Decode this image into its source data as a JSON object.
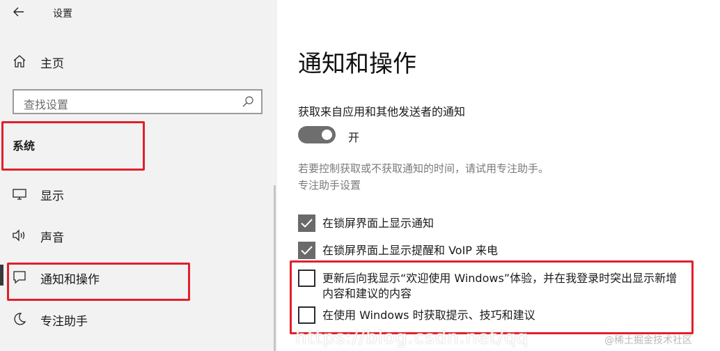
{
  "app": {
    "title": "设置",
    "back_icon": "arrow-left-icon"
  },
  "nav": {
    "home": {
      "label": "主页",
      "icon": "home-icon"
    },
    "group": "系统",
    "items": [
      {
        "label": "显示",
        "icon": "monitor-icon"
      },
      {
        "label": "声音",
        "icon": "speaker-icon"
      },
      {
        "label": "通知和操作",
        "icon": "message-icon",
        "selected": true
      },
      {
        "label": "专注助手",
        "icon": "moon-icon"
      }
    ]
  },
  "search": {
    "placeholder": "查找设置",
    "icon": "search-icon"
  },
  "main": {
    "title": "通知和操作",
    "notifications_label": "获取来自应用和其他发送者的通知",
    "toggle": {
      "state": "开",
      "on": true
    },
    "description": "若要控制获取或不获取通知的时间，请试用专注助手。",
    "focus_link": "专注助手设置",
    "options": [
      {
        "label": "在锁屏界面上显示通知",
        "checked": true
      },
      {
        "label": "在锁屏界面上显示提醒和 VoIP 来电",
        "checked": true
      },
      {
        "label": "更新后向我显示“欢迎使用 Windows”体验，并在我登录时突出显示新增内容和建议的内容",
        "checked": false
      },
      {
        "label": "在使用 Windows 时获取提示、技巧和建议",
        "checked": false
      }
    ]
  },
  "overlay": {
    "url": "https://blog.csdn.net/qq",
    "watermark": "@稀土掘金技术社区"
  },
  "colors": {
    "highlight": "#e0202a",
    "toggle_on": "#6e6e6e",
    "checkbox_on": "#6a6a6a",
    "sidebar_bg": "#f2f2f2"
  }
}
